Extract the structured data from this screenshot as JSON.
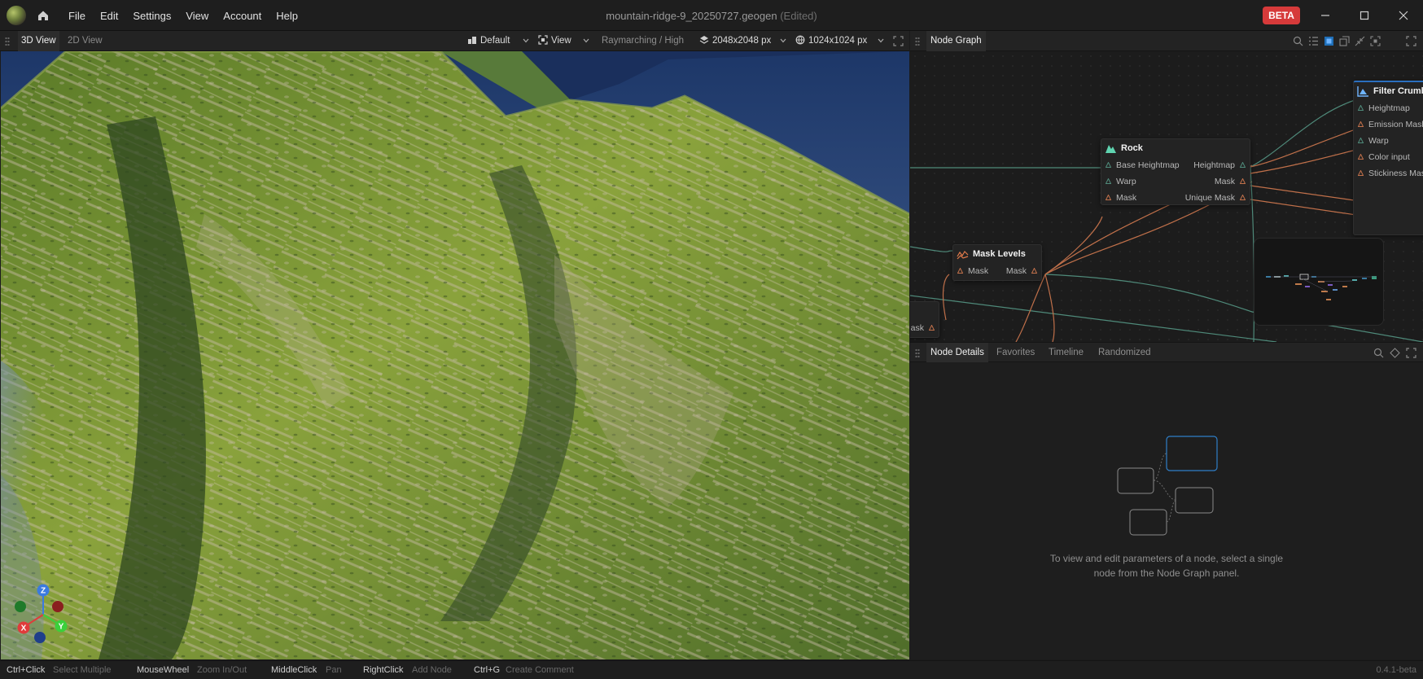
{
  "window": {
    "title": "mountain-ridge-9_20250727.geogen",
    "edited_suffix": "(Edited)",
    "beta_badge": "BETA",
    "accent_color": "#d63a3a"
  },
  "menu": [
    "File",
    "Edit",
    "Settings",
    "View",
    "Account",
    "Help"
  ],
  "viewport_toolbar": {
    "tabs": [
      "3D View",
      "2D View"
    ],
    "active_tab": "3D View",
    "camera_preset": "Default",
    "view_menu": "View",
    "render_mode": "Raymarching / High",
    "terrain_resolution": "2048x2048 px",
    "texture_resolution": "1024x1024 px"
  },
  "gizmo": {
    "axes": [
      "Z",
      "X",
      "Y"
    ]
  },
  "node_graph": {
    "title": "Node Graph",
    "nodes": [
      {
        "name": "Rock",
        "rows": [
          {
            "in": "Base Heightmap",
            "out": "Heightmap"
          },
          {
            "in": "Warp",
            "out": "Mask"
          },
          {
            "in": "Mask",
            "out": "Unique Mask"
          }
        ]
      },
      {
        "name": "Mask Levels",
        "rows": [
          {
            "in": "Mask",
            "out": "Mask"
          }
        ]
      },
      {
        "name": "Filter Crumble",
        "rows": [
          {
            "in": "Heightmap"
          },
          {
            "in": "Emission Mask"
          },
          {
            "in": "Warp"
          },
          {
            "in": "Color input"
          },
          {
            "in": "Stickiness Mask"
          }
        ]
      },
      {
        "name": "",
        "rows": [
          {
            "out": "Mask"
          }
        ]
      }
    ]
  },
  "node_details": {
    "tabs": [
      "Node Details",
      "Favorites",
      "Timeline",
      "Randomized"
    ],
    "active_tab": "Node Details",
    "empty_message_line1": "To view and edit parameters of a node, select a single",
    "empty_message_line2": "node from the Node Graph panel."
  },
  "status_hints": [
    {
      "key": "Ctrl+Click",
      "action": "Select Multiple"
    },
    {
      "key": "MouseWheel",
      "action": "Zoom In/Out"
    },
    {
      "key": "MiddleClick",
      "action": "Pan"
    },
    {
      "key": "RightClick",
      "action": "Add Node"
    },
    {
      "key": "Ctrl+G",
      "action": "Create Comment"
    }
  ],
  "version": "0.4.1-beta",
  "icons": [
    "app-logo",
    "home-icon",
    "camera-preset-icon",
    "view-icon",
    "layers-icon",
    "globe-icon",
    "fullscreen-icon",
    "search-icon",
    "list-icon",
    "node-view-icon",
    "fit-icon",
    "collapse-icon",
    "frame-icon",
    "expand-icon",
    "pin-icon",
    "rock-node-icon",
    "mask-levels-icon",
    "filter-crumble-icon"
  ]
}
